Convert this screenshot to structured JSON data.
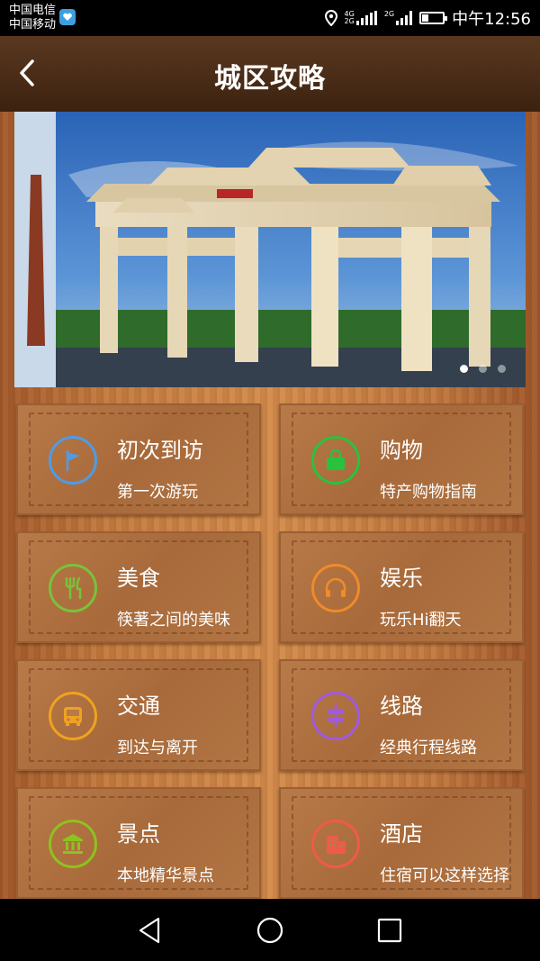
{
  "status_bar": {
    "carrier_1": "中国电信",
    "carrier_2": "中国移动",
    "network_1": "4G",
    "network_2": "2G",
    "network_3": "2G",
    "time": "中午12:56",
    "battery_level": 0.3
  },
  "header": {
    "title": "城区攻略",
    "back_icon": "back-arrow-icon"
  },
  "banner": {
    "slides": 3,
    "active_slide": 1
  },
  "cards": [
    {
      "title": "初次到访",
      "subtitle": "第一次游玩",
      "icon": "flag-icon",
      "color": "#4f9be6"
    },
    {
      "title": "购物",
      "subtitle": "特产购物指南",
      "icon": "shopping-bag-icon",
      "color": "#29c23f"
    },
    {
      "title": "美食",
      "subtitle": "筷著之间的美味",
      "icon": "fork-knife-icon",
      "color": "#79c23a"
    },
    {
      "title": "娱乐",
      "subtitle": "玩乐Hi翻天",
      "icon": "headphones-icon",
      "color": "#f08a2b"
    },
    {
      "title": "交通",
      "subtitle": "到达与离开",
      "icon": "bus-icon",
      "color": "#f0a21f"
    },
    {
      "title": "线路",
      "subtitle": "经典行程线路",
      "icon": "signpost-icon",
      "color": "#a05adf"
    },
    {
      "title": "景点",
      "subtitle": "本地精华景点",
      "icon": "museum-icon",
      "color": "#8dc21f"
    },
    {
      "title": "酒店",
      "subtitle": "住宿可以这样选择",
      "icon": "hotel-icon",
      "color": "#f05a4a"
    }
  ]
}
